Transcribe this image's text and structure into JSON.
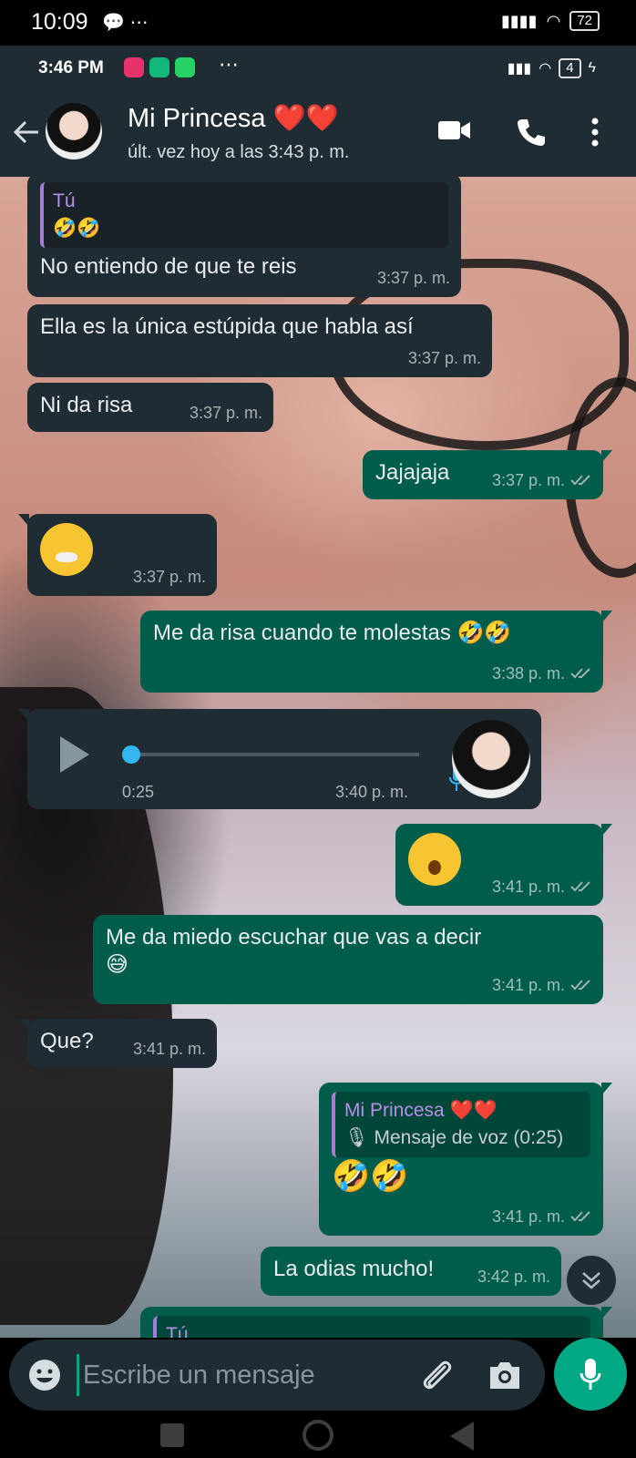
{
  "outer_status": {
    "time": "10:09",
    "battery": "72"
  },
  "inner_status": {
    "time": "3:46 PM",
    "battery": "4"
  },
  "header": {
    "contact_name": "Mi Princesa ❤️❤️",
    "last_seen": "últ. vez hoy a las 3:43 p. m."
  },
  "messages": [
    {
      "direction": "in",
      "quote_author": "Tú",
      "quote_text": "🤣🤣",
      "text": "No entiendo de que te reis",
      "time": "3:37 p. m."
    },
    {
      "direction": "in",
      "text": "Ella es la única estúpida que habla así",
      "time": "3:37 p. m."
    },
    {
      "direction": "in",
      "text": "Ni da risa",
      "time": "3:37 p. m."
    },
    {
      "direction": "out",
      "text": "Jajajaja",
      "time": "3:37 p. m."
    },
    {
      "direction": "in",
      "emoji": "😤",
      "time": "3:37 p. m."
    },
    {
      "direction": "out",
      "text": "Me da risa cuando te molestas 🤣🤣",
      "time": "3:38 p. m."
    },
    {
      "direction": "in",
      "type": "voice",
      "duration": "0:25",
      "time": "3:40 p. m."
    },
    {
      "direction": "out",
      "emoji": "😮",
      "time": "3:41 p. m."
    },
    {
      "direction": "out",
      "text": "Me da miedo escuchar que vas a decir",
      "text2": "😅",
      "time": "3:41 p. m."
    },
    {
      "direction": "in",
      "text": "Que?",
      "time": "3:41 p. m."
    },
    {
      "direction": "out",
      "quote_author": "Mi Princesa ❤️❤️",
      "quote_text": "🎙 Mensaje de voz (0:25)",
      "text": "🤣🤣",
      "time": "3:41 p. m."
    },
    {
      "direction": "out",
      "text": "La odias mucho!",
      "time": "3:42 p. m."
    },
    {
      "direction": "out",
      "quote_author": "Tú",
      "text": "",
      "time": ""
    }
  ],
  "composer": {
    "placeholder": "Escribe un mensaje"
  },
  "colors": {
    "incoming": "#1f2c33",
    "outgoing": "#005c4b",
    "accent": "#00a884"
  }
}
